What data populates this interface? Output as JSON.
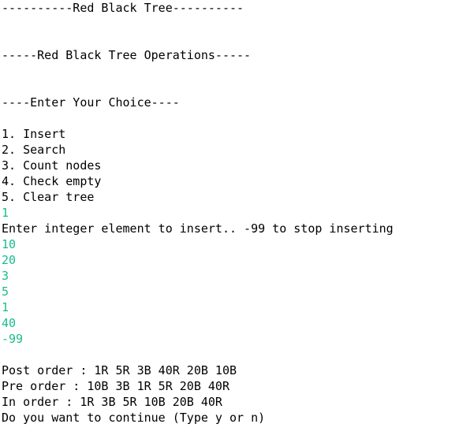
{
  "colors": {
    "background": "#ffffff",
    "output_text": "#000000",
    "user_input_text": "#1abc8c"
  },
  "console": {
    "title": "----------Red Black Tree----------",
    "operations_header": "-----Red Black Tree Operations-----",
    "choice_prompt": "----Enter Your Choice----",
    "menu": [
      "1. Insert",
      "2. Search",
      "3. Count nodes",
      "4. Check empty",
      "5. Clear tree"
    ],
    "choice_input": "1",
    "insert_prompt": "Enter integer element to insert.. -99 to stop inserting",
    "inserted_values": [
      "10",
      "20",
      "3",
      "5",
      "1",
      "40",
      "-99"
    ],
    "post_order": "Post order : 1R 5R 3B 40R 20B 10B",
    "pre_order": "Pre order : 10B 3B 1R 5R 20B 40R",
    "in_order": "In order : 1R 3B 5R 10B 20B 40R",
    "continue_prompt": "Do you want to continue (Type y or n)"
  }
}
